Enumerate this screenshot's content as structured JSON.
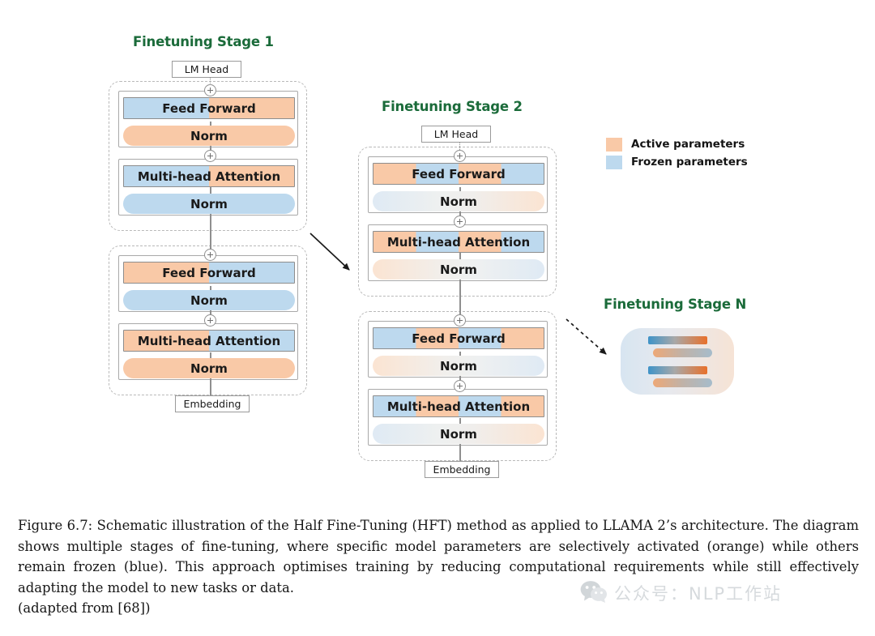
{
  "figure": {
    "stages": [
      {
        "id": "stage-1",
        "title": "Finetuning Stage 1",
        "top_node": "LM Head",
        "bottom_node": "Embedding",
        "blocks": [
          {
            "layers": [
              {
                "name": "Feed Forward",
                "shape": "rect",
                "pattern": "half-blue-orange"
              },
              {
                "name": "Norm",
                "shape": "pill",
                "pattern": "solid-orange"
              }
            ]
          },
          {
            "layers": [
              {
                "name": "Multi-head Attention",
                "shape": "rect",
                "pattern": "half-blue-orange"
              },
              {
                "name": "Norm",
                "shape": "pill",
                "pattern": "solid-blue"
              }
            ]
          },
          {
            "layers": [
              {
                "name": "Feed Forward",
                "shape": "rect",
                "pattern": "half-orange-blue"
              },
              {
                "name": "Norm",
                "shape": "pill",
                "pattern": "solid-blue"
              }
            ]
          },
          {
            "layers": [
              {
                "name": "Multi-head Attention",
                "shape": "rect",
                "pattern": "half-orange-blue"
              },
              {
                "name": "Norm",
                "shape": "pill",
                "pattern": "solid-orange"
              }
            ]
          }
        ]
      },
      {
        "id": "stage-2",
        "title": "Finetuning Stage 2",
        "top_node": "LM Head",
        "bottom_node": "Embedding",
        "blocks": [
          {
            "layers": [
              {
                "name": "Feed Forward",
                "shape": "rect",
                "pattern": "quarters-orange-first"
              },
              {
                "name": "Norm",
                "shape": "pill",
                "pattern": "fade-blue-orange"
              }
            ]
          },
          {
            "layers": [
              {
                "name": "Multi-head Attention",
                "shape": "rect",
                "pattern": "quarters-orange-first"
              },
              {
                "name": "Norm",
                "shape": "pill",
                "pattern": "fade-orange-blue"
              }
            ]
          },
          {
            "layers": [
              {
                "name": "Feed Forward",
                "shape": "rect",
                "pattern": "quarters-blue-first"
              },
              {
                "name": "Norm",
                "shape": "pill",
                "pattern": "fade-orange-blue"
              }
            ]
          },
          {
            "layers": [
              {
                "name": "Multi-head Attention",
                "shape": "rect",
                "pattern": "quarters-blue-first"
              },
              {
                "name": "Norm",
                "shape": "pill",
                "pattern": "fade-blue-orange"
              }
            ]
          }
        ]
      },
      {
        "id": "stage-n",
        "title": "Finetuning Stage N",
        "bars": [
          {
            "shape": "rect",
            "pattern": "gradient-blue-orange-strong"
          },
          {
            "shape": "pill",
            "pattern": "gradient-orange-blue-soft"
          },
          {
            "shape": "rect",
            "pattern": "gradient-blue-orange-strong"
          },
          {
            "shape": "pill",
            "pattern": "gradient-orange-blue-soft"
          }
        ]
      }
    ],
    "legend": {
      "items": [
        {
          "label": "Active parameters",
          "color": "#f9c9a7"
        },
        {
          "label": "Frozen parameters",
          "color": "#bdd9ee"
        }
      ]
    },
    "connector_symbol": "+",
    "arrows": [
      {
        "name": "stage1-to-stage2",
        "style": "solid"
      },
      {
        "name": "stage2-to-stageN",
        "style": "dashed"
      }
    ],
    "colors": {
      "active_orange": "#f9c9a7",
      "frozen_blue": "#bdd9ee",
      "title_green": "#1b6b3a",
      "outline_gray": "#a9a9a9",
      "dashed_gray": "#b9b9b9"
    }
  },
  "caption": {
    "label": "Figure 6.7:",
    "body": "Schematic illustration of the Half Fine-Tuning (HFT) method as applied to LLAMA 2’s architecture. The diagram shows multiple stages of fine-tuning, where specific model parameters are selectively activated (orange) while others remain frozen (blue). This approach optimises training by reducing computational requirements while still effectively adapting the model to new tasks or data.",
    "source": "(adapted from [68])"
  },
  "watermark": {
    "text": "公众号：NLP工作站",
    "icon": "wechat-icon"
  }
}
